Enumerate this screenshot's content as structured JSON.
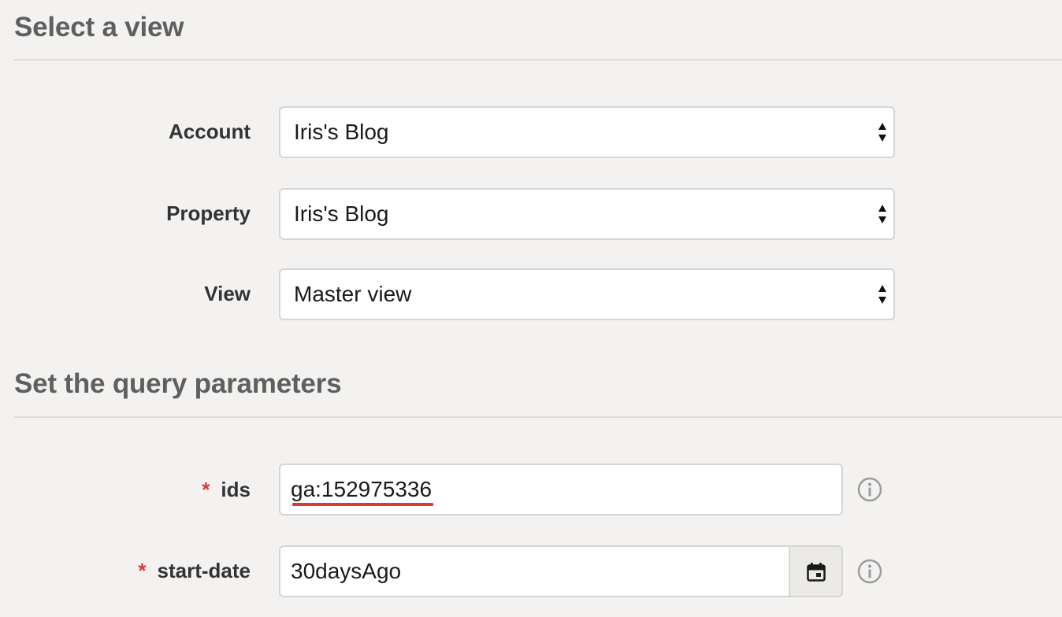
{
  "sections": {
    "view": {
      "title": "Select a view"
    },
    "query": {
      "title": "Set the query parameters"
    }
  },
  "fields": {
    "account": {
      "label": "Account",
      "value": "Iris's Blog"
    },
    "property": {
      "label": "Property",
      "value": "Iris's Blog"
    },
    "view": {
      "label": "View",
      "value": "Master view"
    },
    "ids": {
      "required_mark": "*",
      "label": "ids",
      "value": "ga:152975336"
    },
    "start_date": {
      "required_mark": "*",
      "label": "start-date",
      "value": "30daysAgo"
    }
  },
  "icons": {
    "select_arrows": "up-down-arrows-icon",
    "info": "info-circle-icon",
    "calendar": "calendar-icon"
  },
  "colors": {
    "background": "#f3f2f0",
    "section_title": "#5f5f5f",
    "required": "#d93a2f",
    "spellcheck_underline": "#e03a2f"
  }
}
